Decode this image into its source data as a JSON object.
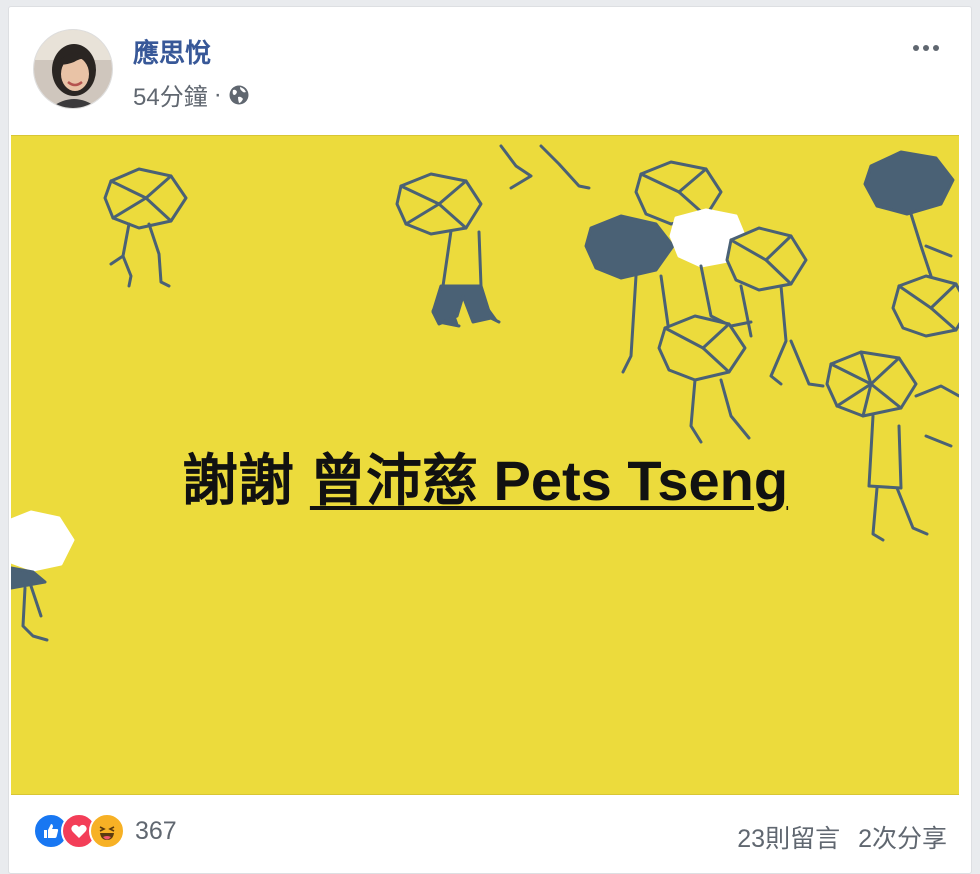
{
  "post": {
    "author": "應思悅",
    "time": "54分鐘",
    "separator": "·",
    "privacy_icon": "globe-icon",
    "more_icon": "more-options-icon"
  },
  "banner": {
    "background_color": "#ecdb3c",
    "illustration_color": "#4a6175",
    "thanks": "謝謝",
    "tagged_name": "曾沛慈 Pets Tseng"
  },
  "footer": {
    "reaction_icons": [
      "like-icon",
      "love-icon",
      "haha-icon"
    ],
    "reaction_count": "367",
    "comments": "23則留言",
    "shares": "2次分享"
  }
}
